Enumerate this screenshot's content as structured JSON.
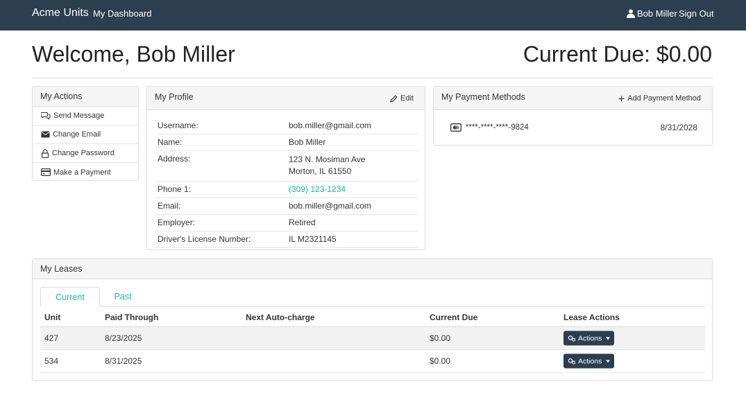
{
  "navbar": {
    "brand": "Acme Units",
    "dashboard": "My Dashboard",
    "user": "Bob Miller",
    "signout": "Sign Out"
  },
  "header": {
    "welcome": "Welcome, Bob Miller",
    "current_due": "Current Due: $0.00"
  },
  "actions": {
    "title": "My Actions",
    "items": [
      {
        "label": "Send Message",
        "icon": "comments-icon"
      },
      {
        "label": "Change Email",
        "icon": "envelope-icon"
      },
      {
        "label": "Change Password",
        "icon": "lock-icon"
      },
      {
        "label": "Make a Payment",
        "icon": "credit-card-icon"
      }
    ]
  },
  "profile": {
    "title": "My Profile",
    "edit": "Edit",
    "rows": [
      {
        "label": "Username:",
        "value": "bob.miller@gmail.com"
      },
      {
        "label": "Name:",
        "value": "Bob Miller"
      },
      {
        "label": "Address:",
        "value": "123 N. Mosiman Ave",
        "value2": "Morton, IL 61550"
      },
      {
        "label": "Phone 1:",
        "value": "(309) 123-1234"
      },
      {
        "label": "Email:",
        "value": "bob.miller@gmail.com"
      },
      {
        "label": "Employer:",
        "value": "Retired"
      },
      {
        "label": "Driver's License Number:",
        "value": "IL M2321145"
      }
    ]
  },
  "payment": {
    "title": "My Payment Methods",
    "add": "Add Payment Method",
    "card_number": "****-****-****-9824",
    "expiry": "8/31/2028"
  },
  "leases": {
    "title": "My Leases",
    "tabs": [
      "Current",
      "Past"
    ],
    "columns": [
      "Unit",
      "Paid Through",
      "Next Auto-charge",
      "Current Due",
      "Lease Actions"
    ],
    "rows": [
      {
        "unit": "427",
        "paid": "8/23/2025",
        "next": "",
        "due": "$0.00",
        "action": "Actions"
      },
      {
        "unit": "534",
        "paid": "8/31/2025",
        "next": "",
        "due": "$0.00",
        "action": "Actions"
      }
    ]
  },
  "colors": {
    "navbar": "#2c3e50",
    "accent": "#18bc9c"
  }
}
